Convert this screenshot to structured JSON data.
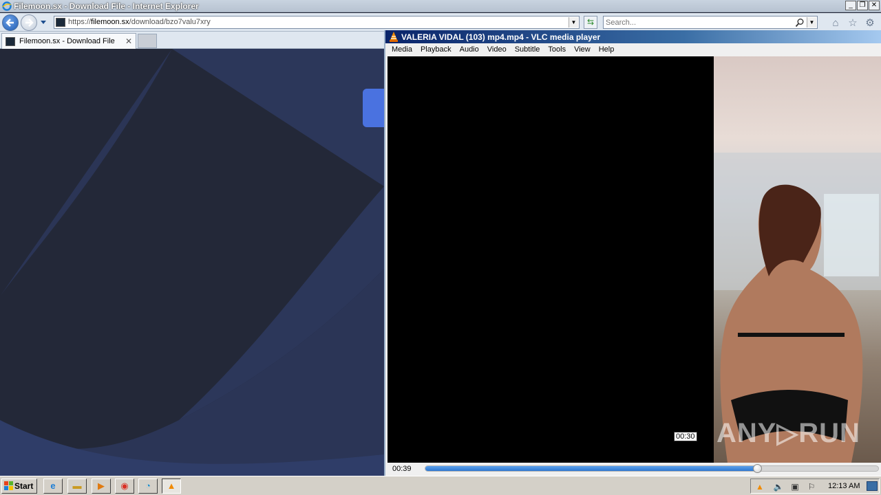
{
  "ie": {
    "window_title": "Filemoon.sx - Download File - Internet Explorer",
    "url_prefix": "https://",
    "url_domain": "filemoon.sx",
    "url_path": "/download/bzo7valu7xry",
    "search_placeholder": "Search...",
    "tab_label": "Filemoon.sx - Download File",
    "tab_close": "✕"
  },
  "vlc": {
    "window_title": "VALERIA VIDAL (103) mp4.mp4 - VLC media player",
    "menu": [
      "Media",
      "Playback",
      "Audio",
      "Video",
      "Subtitle",
      "Tools",
      "View",
      "Help"
    ],
    "elapsed_time": "00:39",
    "seek_tooltip": "00:30",
    "seek_progress": 0.733,
    "watermark": "ANY▷RUN"
  },
  "taskbar": {
    "start_label": "Start",
    "clock": "12:13 AM"
  },
  "colors": {
    "ie_background": "#232838",
    "page_wave": "#2b3556",
    "vlc_seek_fill": "#2f78d0",
    "page_accent": "#4a72e0"
  }
}
